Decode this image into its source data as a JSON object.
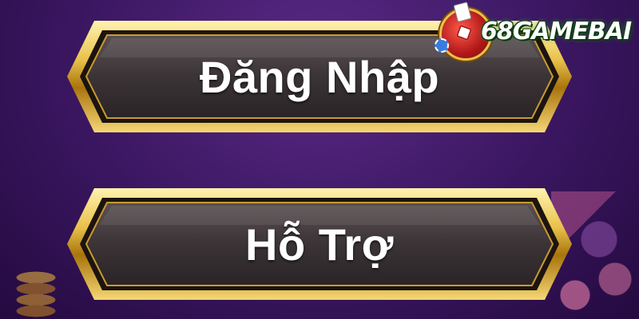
{
  "buttons": {
    "login_label": "Đăng Nhập",
    "support_label": "Hỗ Trợ"
  },
  "logo": {
    "text": "68GAMEBAI"
  },
  "colors": {
    "background": "#3a1660",
    "gold_frame": "#e9c14a",
    "button_fill": "#3b3436",
    "label": "#ffffff",
    "logo_green": "#2d8a2d",
    "logo_red": "#b01818"
  }
}
